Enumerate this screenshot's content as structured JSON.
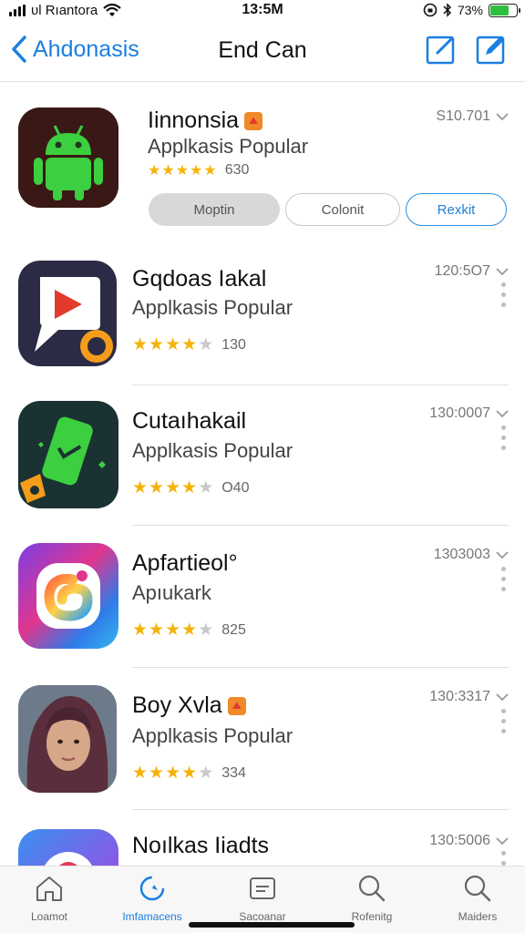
{
  "status_bar": {
    "carrier": "ᴜl Rıantora",
    "time": "13:5M",
    "battery_text": "73%",
    "battery_level": 0.73
  },
  "nav": {
    "back_label": "Ahdonasis",
    "title": "End Can"
  },
  "apps": [
    {
      "name": "Iinnonsia",
      "subtitle": "Applkasis Popular",
      "stars_filled": 4.5,
      "rating_count": "630",
      "meta": "S10.701",
      "buttons": [
        "Moptin",
        "Colonit",
        "Rexkit"
      ],
      "has_badge": true
    },
    {
      "name": "Gqdoas Iakal",
      "subtitle": "Applkasis Popular",
      "stars_filled": 4,
      "rating_count": "130",
      "meta": "120:5O7"
    },
    {
      "name": "Cutaıhakail",
      "subtitle": "Applkasis Popular",
      "stars_filled": 4,
      "rating_count": "O40",
      "meta": "130:0007"
    },
    {
      "name": "Apfartieol°",
      "subtitle": "Apıukark",
      "stars_filled": 4,
      "rating_count": "825",
      "meta": "1303003"
    },
    {
      "name": "Boy Xvla",
      "subtitle": "Applkasis Popular",
      "stars_filled": 4,
      "rating_count": "334",
      "meta": "130:3317",
      "has_badge": true
    },
    {
      "name": "Noılkas Iiadts",
      "subtitle": "",
      "meta": "130:5006"
    }
  ],
  "tabs": [
    {
      "label": "Loamot",
      "icon": "home-icon"
    },
    {
      "label": "Imfamacens",
      "icon": "discover-icon",
      "active": true
    },
    {
      "label": "Sacoanar",
      "icon": "card-icon"
    },
    {
      "label": "Rofenitg",
      "icon": "search-icon"
    },
    {
      "label": "Maiders",
      "icon": "search-icon"
    }
  ],
  "colors": {
    "accent": "#1a7fe0",
    "star": "#f5b30a",
    "divider": "#e0e0e0"
  }
}
